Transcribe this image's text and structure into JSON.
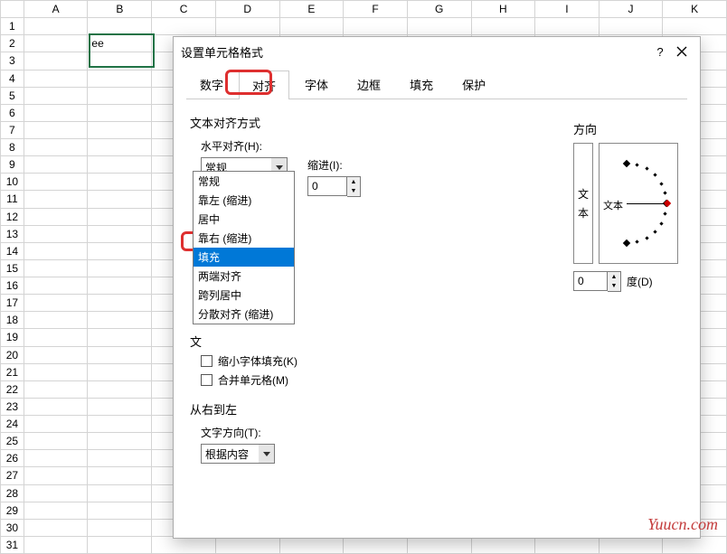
{
  "spreadsheet": {
    "columns": [
      "A",
      "B",
      "C",
      "D",
      "E",
      "F",
      "G",
      "H",
      "I",
      "J",
      "K"
    ],
    "rows": [
      "1",
      "2",
      "3",
      "4",
      "5",
      "6",
      "7",
      "8",
      "9",
      "10",
      "11",
      "12",
      "13",
      "14",
      "15",
      "16",
      "17",
      "18",
      "19",
      "20",
      "21",
      "22",
      "23",
      "24",
      "25",
      "26",
      "27",
      "28",
      "29",
      "30",
      "31"
    ],
    "cells": {
      "B2": "ee"
    }
  },
  "dialog": {
    "title": "设置单元格格式",
    "help": "?",
    "close": "×",
    "tabs": [
      "数字",
      "对齐",
      "字体",
      "边框",
      "填充",
      "保护"
    ],
    "active_tab_index": 1,
    "align": {
      "section": "文本对齐方式",
      "h_label": "水平对齐(H):",
      "h_value": "常规",
      "h_options": [
        "常规",
        "靠左 (缩进)",
        "居中",
        "靠右 (缩进)",
        "填充",
        "两端对齐",
        "跨列居中",
        "分散对齐 (缩进)"
      ],
      "h_highlight_index": 4,
      "indent_label": "缩进(I):",
      "indent_value": "0"
    },
    "control": {
      "section": "文",
      "shrink": "缩小字体填充(K)",
      "merge": "合并单元格(M)"
    },
    "rtl": {
      "section": "从右到左",
      "dir_label": "文字方向(T):",
      "dir_value": "根据内容"
    },
    "orient": {
      "section": "方向",
      "vertical_text": "文本",
      "dial_text": "文本",
      "degree_value": "0",
      "degree_label": "度(D)"
    }
  },
  "watermark": "Yuucn.com"
}
